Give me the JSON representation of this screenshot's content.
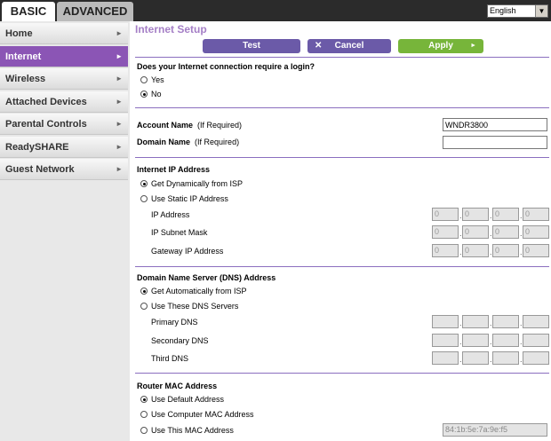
{
  "tabs": {
    "basic": "BASIC",
    "advanced": "ADVANCED"
  },
  "language": {
    "selected": "English"
  },
  "sidebar": {
    "items": [
      {
        "label": "Home"
      },
      {
        "label": "Internet",
        "active": true
      },
      {
        "label": "Wireless"
      },
      {
        "label": "Attached Devices"
      },
      {
        "label": "Parental Controls"
      },
      {
        "label": "ReadySHARE"
      },
      {
        "label": "Guest Network"
      }
    ]
  },
  "main": {
    "title": "Internet Setup",
    "buttons": {
      "test": "Test",
      "cancel": "Cancel",
      "apply": "Apply"
    },
    "login_question": "Does your Internet connection require a login?",
    "login_options": {
      "yes": "Yes",
      "no": "No",
      "selected": "No"
    },
    "account_name": {
      "label": "Account Name",
      "hint": "(If Required)",
      "value": "WNDR3800"
    },
    "domain_name": {
      "label": "Domain Name",
      "hint": "(If Required)",
      "value": ""
    },
    "ip_section": {
      "heading": "Internet IP Address",
      "option_dynamic": "Get Dynamically from ISP",
      "option_static": "Use Static IP Address",
      "selected": "Get Dynamically from ISP",
      "fields": {
        "ip": {
          "label": "IP Address",
          "octets": [
            "0",
            "0",
            "0",
            "0"
          ]
        },
        "mask": {
          "label": "IP Subnet Mask",
          "octets": [
            "0",
            "0",
            "0",
            "0"
          ]
        },
        "gateway": {
          "label": "Gateway IP Address",
          "octets": [
            "0",
            "0",
            "0",
            "0"
          ]
        }
      }
    },
    "dns_section": {
      "heading": "Domain Name Server (DNS) Address",
      "option_auto": "Get Automatically from ISP",
      "option_manual": "Use These DNS Servers",
      "selected": "Get Automatically from ISP",
      "fields": {
        "primary": {
          "label": "Primary DNS"
        },
        "secondary": {
          "label": "Secondary DNS"
        },
        "third": {
          "label": "Third DNS"
        }
      }
    },
    "mac_section": {
      "heading": "Router MAC Address",
      "option_default": "Use Default Address",
      "option_computer": "Use Computer MAC Address",
      "option_this": "Use This MAC Address",
      "selected": "Use Default Address",
      "mac_value": "84:1b:5e:7a:9e:f5"
    }
  },
  "colors": {
    "accent_purple": "#8b55b5",
    "title_purple": "#a57fc6",
    "apply_green": "#77b53a",
    "button_purple": "#6b5aa8"
  },
  "icons": {
    "nav_chevron": "chevron-right-icon",
    "cancel_x": "close-icon",
    "apply_arrow": "play-arrow-icon",
    "dropdown": "chevron-down-icon"
  }
}
